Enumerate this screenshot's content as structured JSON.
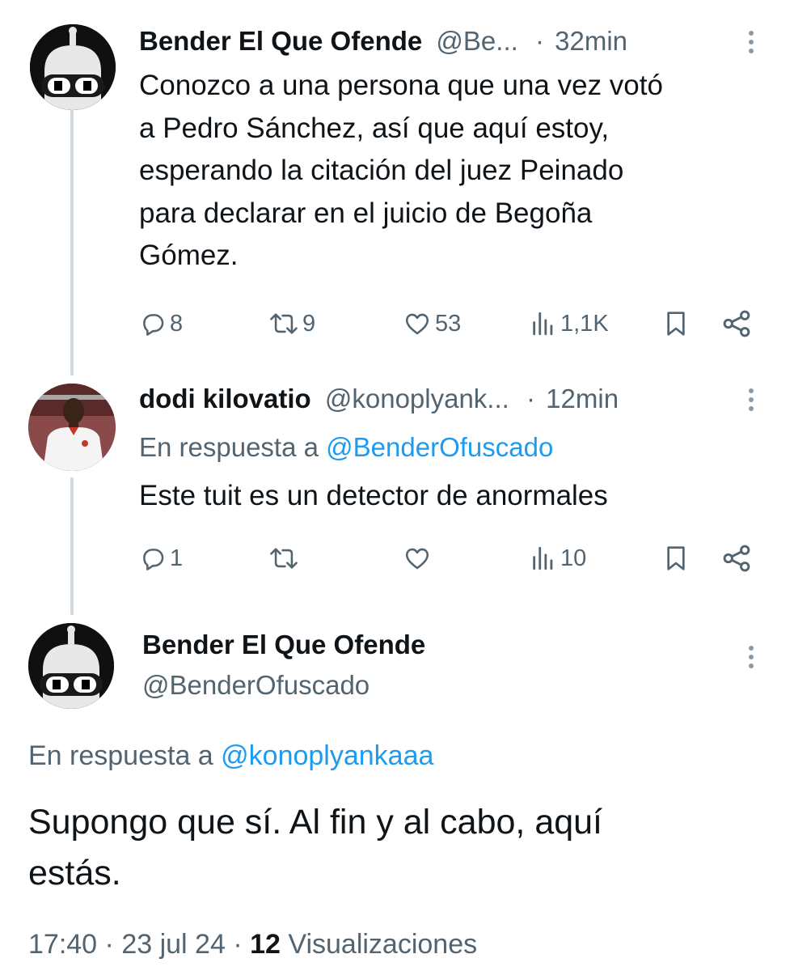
{
  "tweets": [
    {
      "author": "Bender El Que Ofende",
      "handle": "@Be...",
      "sep": "·",
      "time": "32min",
      "avatar_icon": "bender-robot-avatar",
      "text_lines": [
        "Conozco a una persona que una vez votó",
        "a Pedro Sánchez, así que aquí estoy,",
        "esperando la citación del juez Peinado",
        "para declarar en el juicio de Begoña",
        "Gómez."
      ],
      "actions": {
        "replies": "8",
        "retweets": "9",
        "likes": "53",
        "views": "1,1K"
      }
    },
    {
      "author": "dodi kilovatio",
      "handle": "@konoplyank...",
      "sep": "·",
      "time": "12min",
      "avatar_icon": "football-player-avatar",
      "reply_prefix": "En respuesta a",
      "reply_to": "@BenderOfuscado",
      "text_lines": [
        "Este tuit es un detector de anormales"
      ],
      "actions": {
        "replies": "1",
        "retweets": "",
        "likes": "",
        "views": "10"
      }
    }
  ],
  "main_tweet": {
    "author": "Bender El Que Ofende",
    "handle": "@BenderOfuscado",
    "avatar_icon": "bender-robot-avatar",
    "reply_prefix": "En respuesta a",
    "reply_to": "@konoplyankaaa",
    "text_lines": [
      "Supongo que sí. Al fin y al cabo, aquí",
      "estás."
    ],
    "time": "17:40",
    "sep1": "·",
    "date": "23 jul 24",
    "sep2": "·",
    "views_count": "12",
    "views_label": "Visualizaciones"
  },
  "colors": {
    "link": "#1d9bf0",
    "muted": "#536471",
    "text": "#0f1419",
    "thread_line": "#cfd9de"
  }
}
